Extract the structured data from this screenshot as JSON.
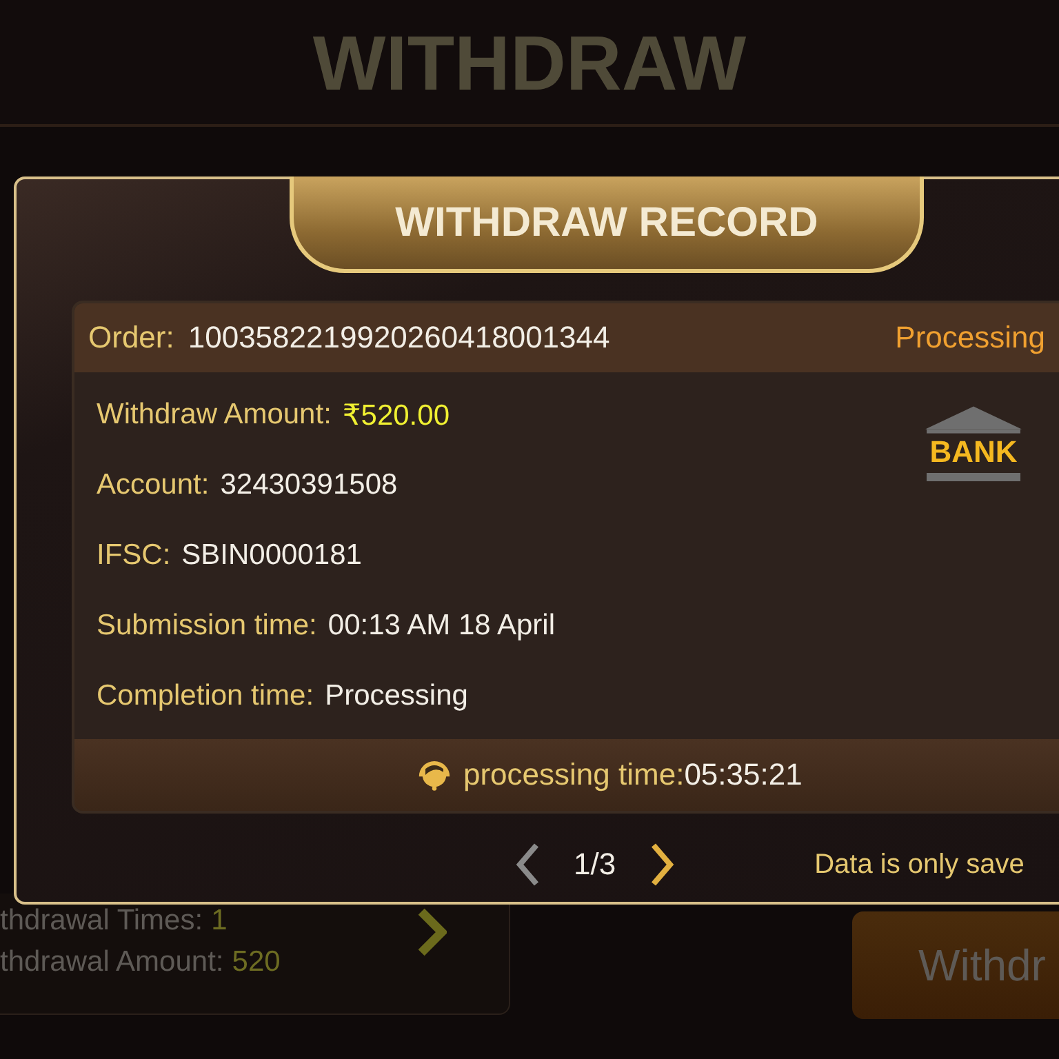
{
  "page": {
    "title": "WITHDRAW"
  },
  "stats": [
    {
      "label": "thdrawal Times:",
      "value": "1"
    },
    {
      "label": "thdrawal Amount:",
      "value": "520"
    }
  ],
  "withdraw_button": {
    "label": "Withdr"
  },
  "dialog": {
    "title": "WITHDRAW RECORD",
    "record": {
      "order_label": "Order:",
      "order": "1003582219920260418001344",
      "status": "Processing",
      "fields": [
        {
          "label": "Withdraw Amount:",
          "value": "₹520.00",
          "kind": "amount"
        },
        {
          "label": "Account:",
          "value": "32430391508",
          "kind": "plain"
        },
        {
          "label": "IFSC:",
          "value": "SBIN0000181",
          "kind": "plain"
        },
        {
          "label": "Submission time:",
          "value": "00:13 AM 18 April",
          "kind": "plain"
        },
        {
          "label": "Completion time:",
          "value": "Processing",
          "kind": "plain"
        }
      ],
      "bank_label": "BANK",
      "processing_label": "processing time:",
      "processing_time": "05:35:21"
    },
    "pager": {
      "prev_disabled": true,
      "page": "1/3",
      "next_disabled": false
    },
    "note": "Data is only save"
  }
}
